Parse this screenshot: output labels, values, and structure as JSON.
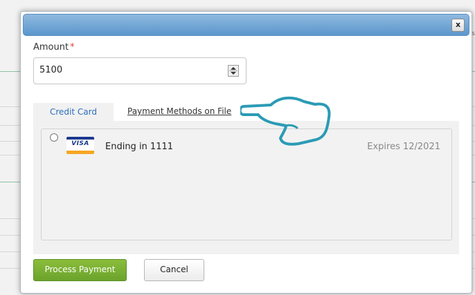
{
  "background": {
    "right_edge_text": "s"
  },
  "modal": {
    "close_label": "x",
    "amount": {
      "label": "Amount",
      "required_mark": "*",
      "value": "5100"
    },
    "tabs": [
      {
        "label": "Credit Card",
        "active": true
      },
      {
        "label": "Payment Methods on File",
        "active": false
      }
    ],
    "saved_cards": [
      {
        "brand": "VISA",
        "description": "Ending in 1111",
        "expiry": "Expires 12/2021",
        "selected": false
      }
    ],
    "actions": {
      "process_label": "Process Payment",
      "cancel_label": "Cancel"
    }
  },
  "colors": {
    "header_gradient_top": "#8fb9df",
    "header_gradient_bottom": "#5b97cc",
    "tab_active_text": "#2a6ebb",
    "process_button": "#7ab035",
    "annotation_stroke": "#2b9bb5",
    "required_star": "#e0443c"
  },
  "icons": {
    "spinner": "up-down-stepper-icon",
    "card_brand": "visa-card-icon",
    "annotation": "pointing-hand-icon"
  }
}
